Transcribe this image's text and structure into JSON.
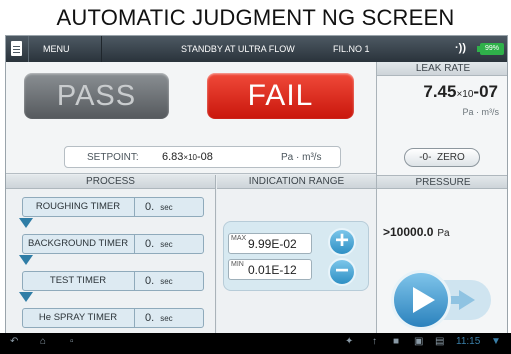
{
  "caption": "AUTOMATIC JUDGMENT NG SCREEN",
  "topbar": {
    "menu_label": "MENU",
    "status": "STANDBY AT ULTRA FLOW",
    "filament": "FIL.NO 1",
    "sound_icon": "speaker-icon",
    "battery": "99%"
  },
  "judgment": {
    "pass_label": "PASS",
    "fail_label": "FAIL",
    "result": "FAIL",
    "colors": {
      "fail": "#e3261b",
      "pass_inactive": "#6e7377"
    }
  },
  "setpoint": {
    "label": "SETPOINT:",
    "mantissa": "6.83",
    "times_ten": "×10",
    "exponent": "-08",
    "unit": "Pa · m³/s"
  },
  "leak_rate": {
    "header": "LEAK RATE",
    "mantissa": "7.45",
    "times_ten": "×10",
    "exponent": "-07",
    "unit": "Pa · m³/s",
    "zero_prefix": "-0-",
    "zero_label": "ZERO"
  },
  "process": {
    "header": "PROCESS",
    "timers": [
      {
        "label": "ROUGHING TIMER",
        "value": "0.",
        "unit": "sec"
      },
      {
        "label": "BACKGROUND TIMER",
        "value": "0.",
        "unit": "sec"
      },
      {
        "label": "TEST TIMER",
        "value": "0.",
        "unit": "sec"
      },
      {
        "label": "He SPRAY TIMER",
        "value": "0.",
        "unit": "sec"
      }
    ]
  },
  "indication_range": {
    "header": "INDICATION RANGE",
    "max_label": "MAX",
    "max_value": "9.99E-02",
    "min_label": "MIN",
    "min_value": "0.01E-12",
    "plus": "+",
    "minus": "−"
  },
  "pressure": {
    "header": "PRESSURE",
    "value": ">10000.0",
    "unit": "Pa"
  },
  "navbar": {
    "clock": "11:15"
  }
}
